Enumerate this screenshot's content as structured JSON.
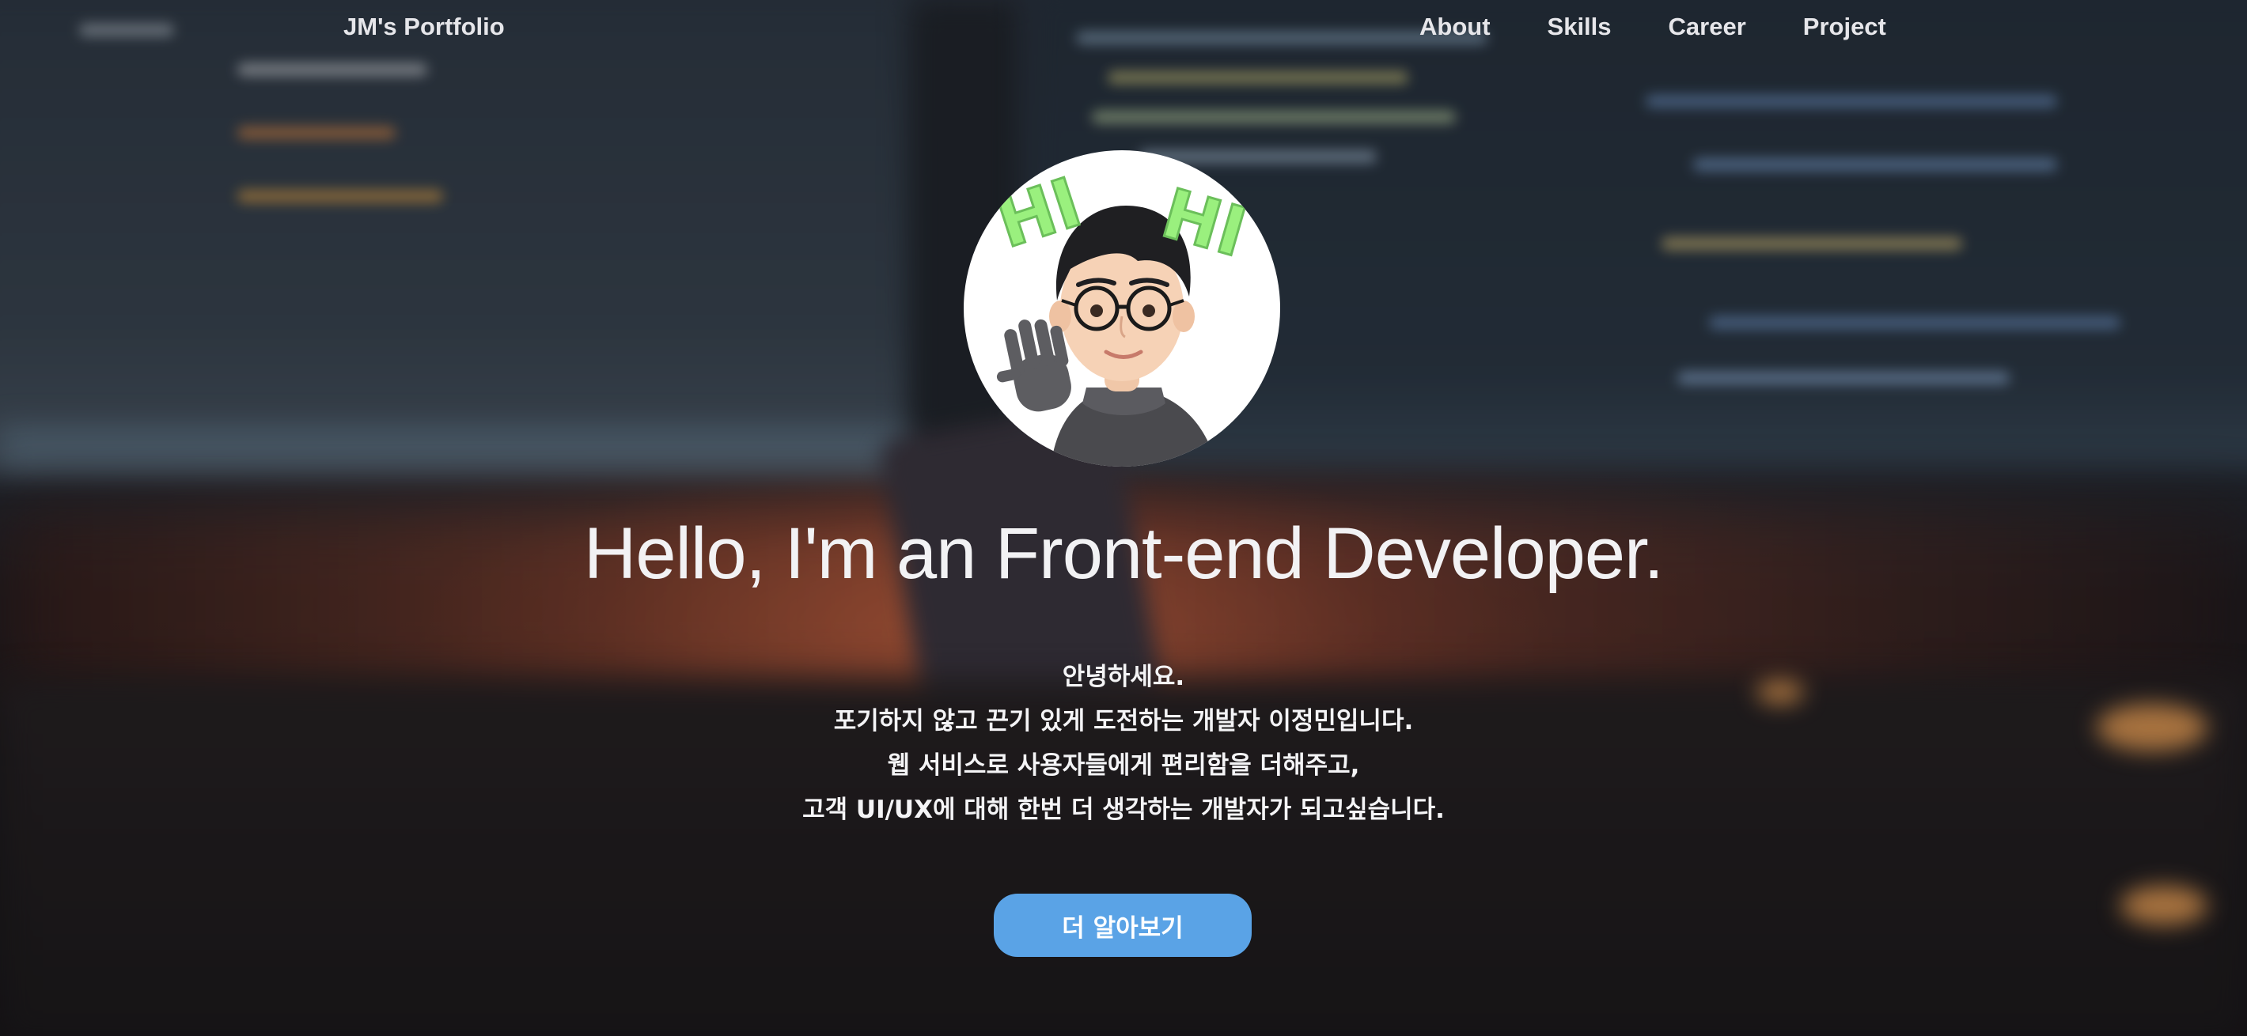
{
  "nav": {
    "brand": "JM's Portfolio",
    "links": [
      "About",
      "Skills",
      "Career",
      "Project"
    ]
  },
  "avatar": {
    "badge_left": "HI",
    "badge_right": "HI"
  },
  "hero": {
    "headline": "Hello, I'm an Front-end Developer.",
    "intro_lines": [
      "안녕하세요.",
      "포기하지 않고 끈기 있게 도전하는 개발자 이정민입니다.",
      "웹 서비스로 사용자들에게 편리함을 더해주고,",
      "고객 UI/UX에 대해 한번 더 생각하는 개발자가 되고싶습니다."
    ],
    "cta_label": "더 알아보기"
  },
  "colors": {
    "cta": "#5aa3e6",
    "text": "#f2f2f4",
    "badge": "#9af07e"
  }
}
